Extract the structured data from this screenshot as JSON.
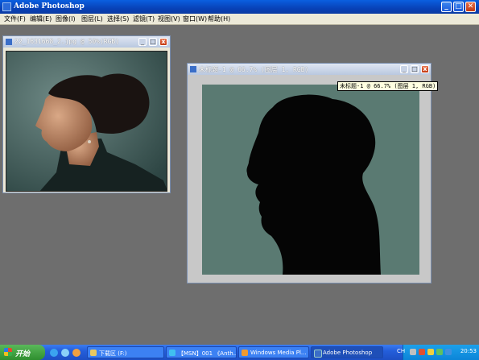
{
  "app": {
    "title": "Adobe Photoshop",
    "min": "_",
    "max": "□",
    "close": "✕"
  },
  "menu": [
    "文件(F)",
    "编辑(E)",
    "图像(I)",
    "图层(L)",
    "选择(S)",
    "滤镜(T)",
    "视图(V)",
    "窗口(W)",
    "帮助(H)"
  ],
  "doc1": {
    "title": "22_1631668_2.jpg @ 50%(RGB)"
  },
  "doc2": {
    "title": "未标题-1 @ 66.7% (图层 1, RGB)",
    "tooltip": "未标题-1 @ 66.7% (图层 1, RGB)"
  },
  "taskbar": {
    "start": "开始",
    "tasks": [
      {
        "label": "下载区 (F:)",
        "active": false
      },
      {
        "label": "【MSN】001 《Anth...",
        "active": false
      },
      {
        "label": "Windows Media Pl...",
        "active": false
      },
      {
        "label": "Adobe Photoshop",
        "active": true
      }
    ],
    "tray_lang": "CH",
    "clock": "20:53"
  },
  "colors": {
    "canvas_bg": "#5a7a72",
    "photo_bg": "#3f5f5c",
    "silhouette": "#050505"
  }
}
